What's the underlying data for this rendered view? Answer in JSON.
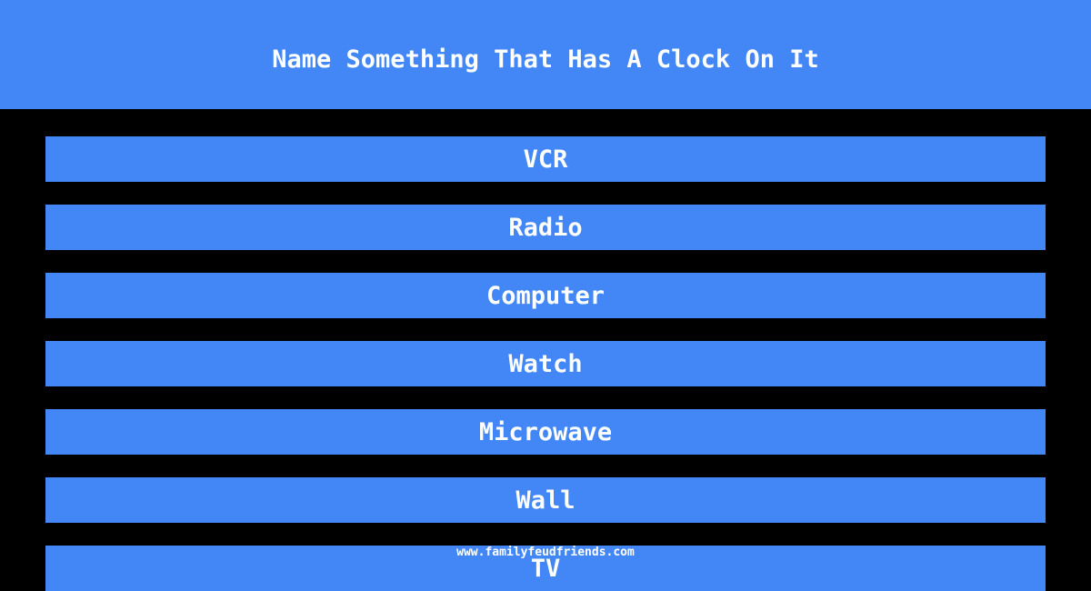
{
  "header": {
    "title": "Name Something That Has A Clock On It"
  },
  "answers": [
    "VCR",
    "Radio",
    "Computer",
    "Watch",
    "Microwave",
    "Wall",
    "TV"
  ],
  "footer": {
    "watermark": "www.familyfeudfriends.com"
  },
  "colors": {
    "accent": "#4287f5",
    "background": "#000000",
    "text": "#ffffff"
  }
}
